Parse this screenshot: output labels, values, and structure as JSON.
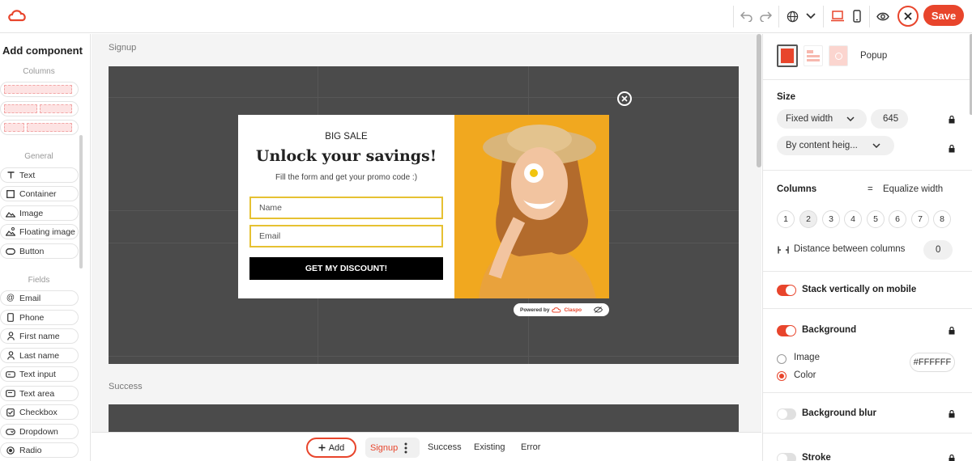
{
  "topbar": {
    "save_label": "Save",
    "icons": [
      "cloud-logo-icon",
      "undo-icon",
      "redo-icon",
      "globe-icon",
      "chevron-down-icon",
      "desktop-icon",
      "mobile-icon",
      "eye-icon",
      "close-icon"
    ],
    "accent": "#e8452c"
  },
  "left": {
    "title": "Add component",
    "columns_label": "Columns",
    "general_label": "General",
    "general_items": [
      {
        "label": "Text",
        "icon": "text-icon"
      },
      {
        "label": "Container",
        "icon": "container-icon"
      },
      {
        "label": "Image",
        "icon": "image-icon"
      },
      {
        "label": "Floating image",
        "icon": "floating-image-icon"
      },
      {
        "label": "Button",
        "icon": "button-icon"
      }
    ],
    "fields_label": "Fields",
    "field_items": [
      {
        "label": "Email",
        "icon": "at-icon"
      },
      {
        "label": "Phone",
        "icon": "phone-icon"
      },
      {
        "label": "First name",
        "icon": "person-icon"
      },
      {
        "label": "Last name",
        "icon": "person-icon"
      },
      {
        "label": "Text input",
        "icon": "text-input-icon"
      },
      {
        "label": "Text area",
        "icon": "text-area-icon"
      },
      {
        "label": "Checkbox",
        "icon": "checkbox-icon"
      },
      {
        "label": "Dropdown",
        "icon": "dropdown-icon"
      },
      {
        "label": "Radio",
        "icon": "radio-icon"
      }
    ]
  },
  "canvas": {
    "signup_label": "Signup",
    "success_label": "Success",
    "popup": {
      "eyebrow": "BIG SALE",
      "headline": "Unlock your savings!",
      "subtext": "Fill the form and get your promo code :)",
      "name_placeholder": "Name",
      "email_placeholder": "Email",
      "cta": "GET MY DISCOUNT!",
      "powered_by": "Powered by",
      "brand": "Claspo"
    }
  },
  "bottombar": {
    "add_label": "Add",
    "active_tab": "Signup",
    "tabs": [
      "Success",
      "Existing",
      "Error"
    ]
  },
  "right": {
    "mode_label": "Popup",
    "size": {
      "title": "Size",
      "width_mode": "Fixed width",
      "width_value": "645",
      "height_mode": "By content heig..."
    },
    "columns": {
      "title": "Columns",
      "equalize_symbol": "=",
      "equalize_label": "Equalize width",
      "numbers": [
        "1",
        "2",
        "3",
        "4",
        "5",
        "6",
        "7",
        "8"
      ],
      "selected": "2",
      "distance_label": "Distance between columns",
      "distance_value": "0"
    },
    "stack_label": "Stack vertically on mobile",
    "background": {
      "title": "Background",
      "option_image": "Image",
      "option_color": "Color",
      "selected": "Color",
      "color_value": "#FFFFFF"
    },
    "blur_label": "Background blur",
    "stroke_label": "Stroke"
  }
}
